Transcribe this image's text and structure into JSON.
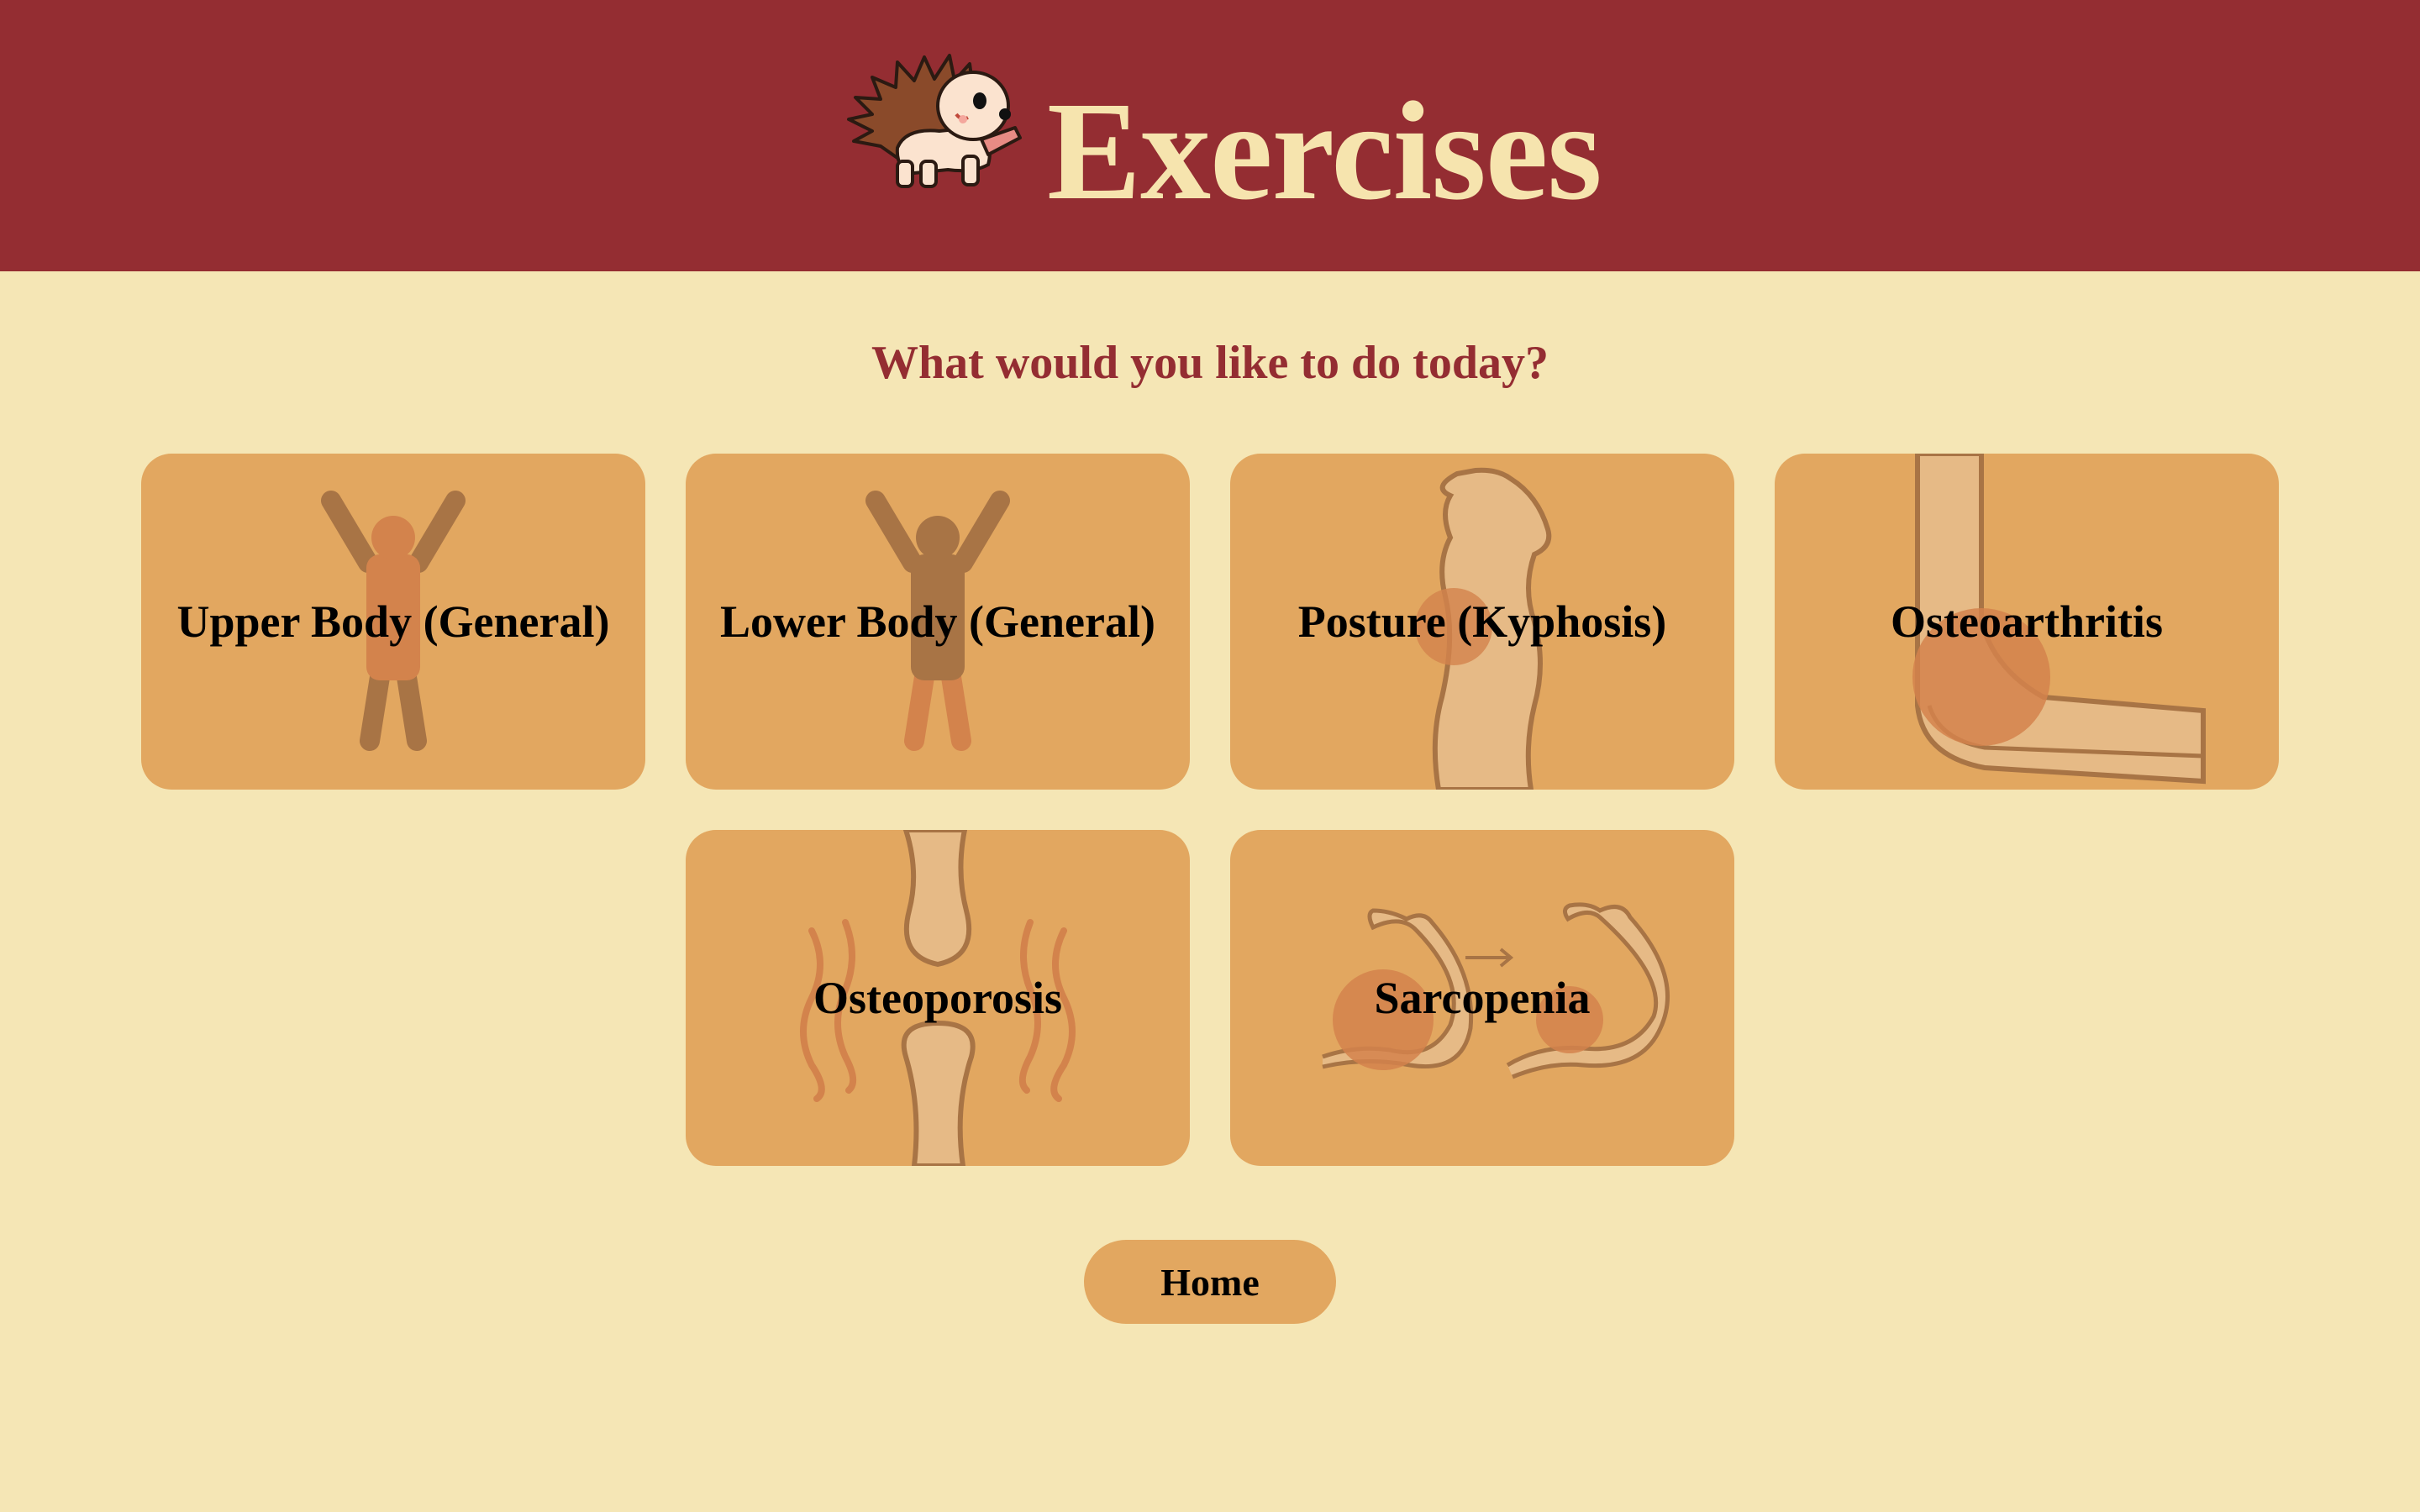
{
  "header": {
    "title": "Exercises",
    "mascot_icon": "hedgehog-mascot-icon"
  },
  "main": {
    "prompt": "What would you like to do today?",
    "cards": [
      {
        "label": "Upper Body (General)",
        "icon": "person-arms-raised-icon"
      },
      {
        "label": "Lower Body (General)",
        "icon": "person-legs-highlight-icon"
      },
      {
        "label": "Posture (Kyphosis)",
        "icon": "spine-profile-icon"
      },
      {
        "label": "Osteoarthritis",
        "icon": "elbow-joint-icon"
      },
      {
        "label": "Osteoporosis",
        "icon": "knee-bone-icon"
      },
      {
        "label": "Sarcopenia",
        "icon": "flexed-arm-icon"
      }
    ]
  },
  "footer": {
    "home_label": "Home"
  },
  "colors": {
    "header_bg": "#942d32",
    "page_bg": "#f5e6b5",
    "card_bg": "#e2a760",
    "title_text": "#f6e4ae",
    "prompt_text": "#942d32"
  }
}
